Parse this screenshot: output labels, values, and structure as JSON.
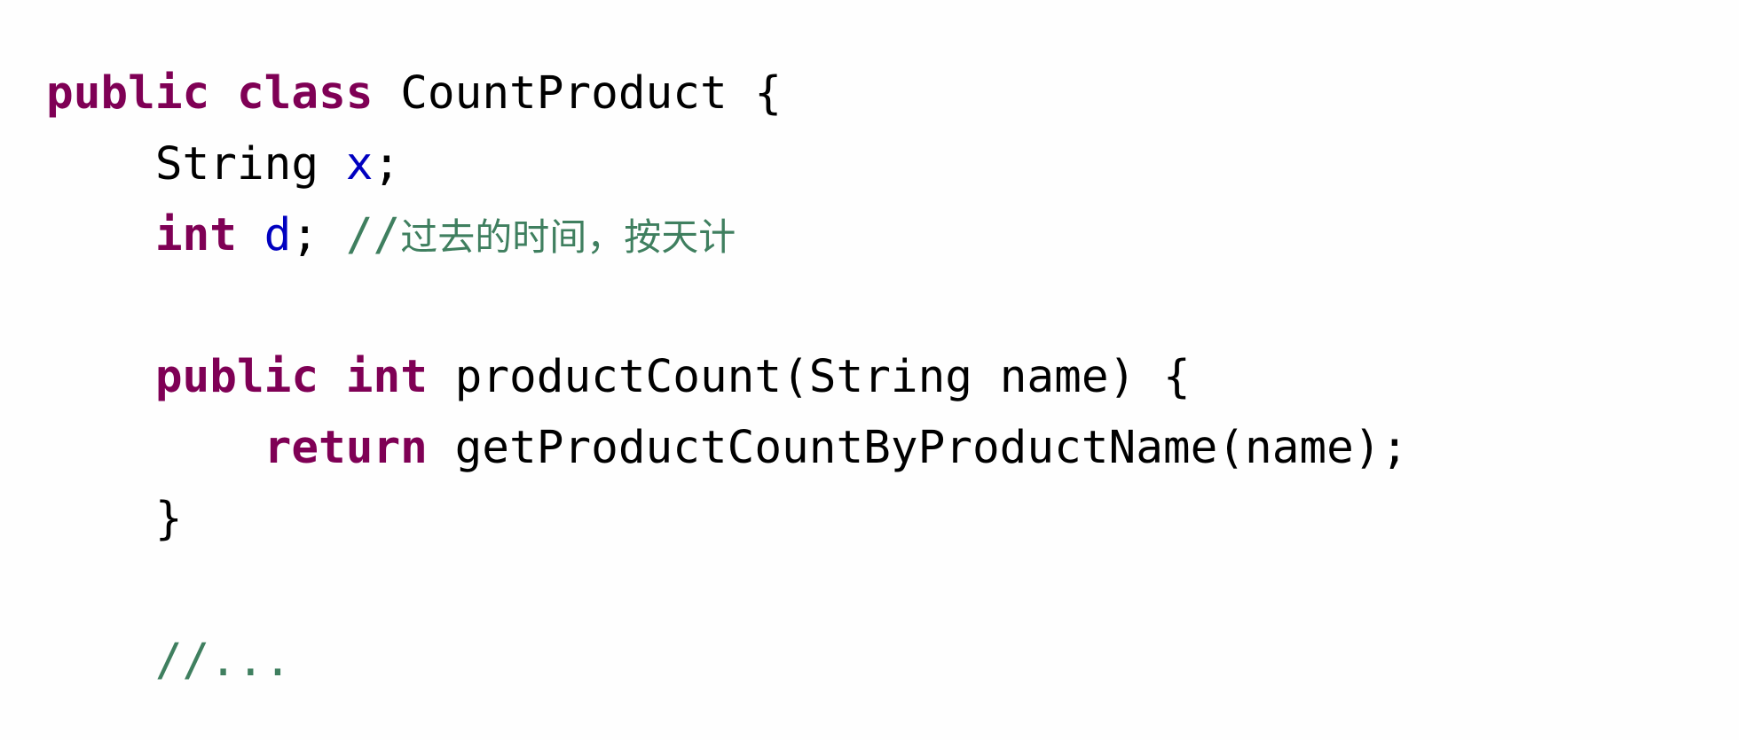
{
  "code_lines": [
    {
      "kw1": "public",
      "kw2": "class",
      "name": "CountProduct",
      "brace": "{"
    },
    {
      "type": "String",
      "field": "x",
      "semi": ";"
    },
    {
      "kw": "int",
      "field": "d",
      "semi": ";",
      "comment_slashes": "//",
      "comment_text": "过去的时间，按天计"
    },
    {},
    {
      "kw1": "public",
      "kw2": "int",
      "signature": "productCount(String name) {"
    },
    {
      "kw": "return",
      "call": "getProductCountByProductName(name);"
    },
    {
      "brace": "}"
    },
    {},
    {
      "comment": "//..."
    }
  ]
}
